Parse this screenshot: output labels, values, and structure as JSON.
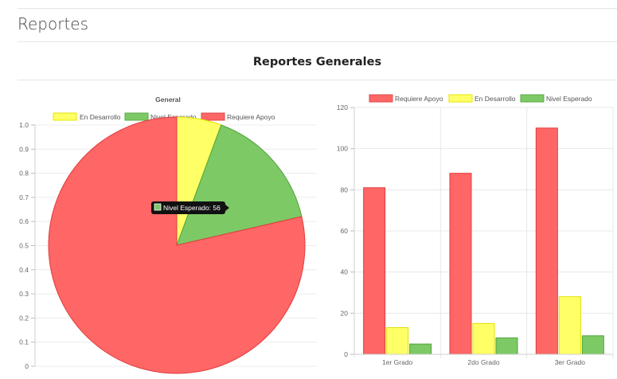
{
  "header": {
    "title": "Reportes"
  },
  "section": {
    "title": "Reportes Generales"
  },
  "colors": {
    "rojo": "#ff6666",
    "amarillo": "#ffff66",
    "verde": "#7dc966"
  },
  "charts": {
    "pie": {
      "title": "General",
      "legend": [
        {
          "label": "En Desarrollo",
          "color": "#ffff66"
        },
        {
          "label": "Nivel Esperado",
          "color": "#7dc966"
        },
        {
          "label": "Requiere Apoyo",
          "color": "#ff6666"
        }
      ],
      "y_ticks": [
        "1.0",
        "0.9",
        "0.8",
        "0.7",
        "0.6",
        "0.5",
        "0.4",
        "0.3",
        "0.2",
        "0.1",
        "0"
      ],
      "tooltip": "Nivel Esperado: 56"
    },
    "bar": {
      "legend": [
        {
          "label": "Requiere Apoyo",
          "color": "#ff6666"
        },
        {
          "label": "En Desarrollo",
          "color": "#ffff66"
        },
        {
          "label": "Nivel Esperado",
          "color": "#7dc966"
        }
      ]
    }
  },
  "chart_data": [
    {
      "type": "pie",
      "title": "General",
      "slices": [
        {
          "name": "En Desarrollo",
          "value": 20
        },
        {
          "name": "Nivel Esperado",
          "value": 56
        },
        {
          "name": "Requiere Apoyo",
          "value": 279
        }
      ],
      "ylim": [
        0,
        1.0
      ],
      "legend_position": "top"
    },
    {
      "type": "bar",
      "categories": [
        "1er Grado",
        "2do Grado",
        "3er Grado"
      ],
      "series": [
        {
          "name": "Requiere Apoyo",
          "values": [
            81,
            88,
            110
          ]
        },
        {
          "name": "En Desarrollo",
          "values": [
            13,
            15,
            28
          ]
        },
        {
          "name": "Nivel Esperado",
          "values": [
            5,
            8,
            9
          ]
        }
      ],
      "ylim": [
        0,
        120
      ],
      "y_ticks": [
        "0",
        "20",
        "40",
        "60",
        "80",
        "100",
        "120"
      ],
      "grid": true,
      "legend_position": "top"
    }
  ]
}
